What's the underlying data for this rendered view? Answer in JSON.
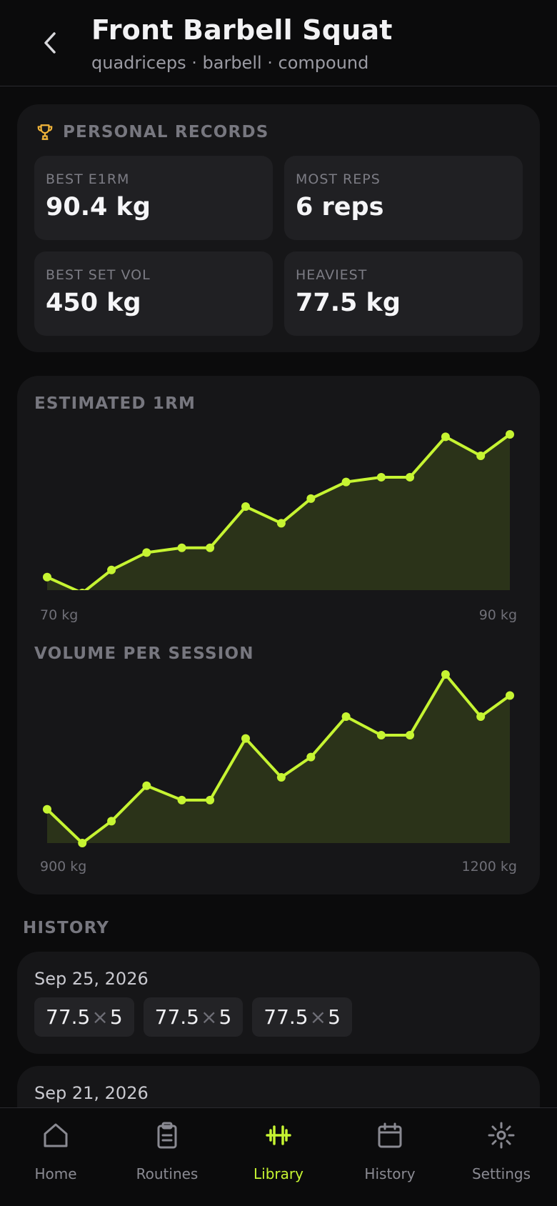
{
  "header": {
    "title": "Front Barbell Squat",
    "subtitle": "quadriceps · barbell · compound"
  },
  "personal_records": {
    "heading": "PERSONAL RECORDS",
    "stats": [
      {
        "label": "BEST E1RM",
        "value": "90.4 kg"
      },
      {
        "label": "MOST REPS",
        "value": "6 reps"
      },
      {
        "label": "BEST SET VOL",
        "value": "450 kg"
      },
      {
        "label": "HEAVIEST",
        "value": "77.5 kg"
      }
    ]
  },
  "colors": {
    "accent": "#c6f432",
    "area_fill": "#2b3319",
    "trophy": "#f2b53a"
  },
  "chart_data": [
    {
      "type": "line",
      "title": "ESTIMATED 1RM",
      "min_label": "70 kg",
      "max_label": "90 kg",
      "x": [
        1,
        2,
        3,
        4,
        5,
        6,
        7,
        8,
        9,
        10,
        11,
        12,
        13,
        14,
        15
      ],
      "values": [
        0.1,
        0.0,
        0.145,
        0.255,
        0.285,
        0.285,
        0.545,
        0.44,
        0.595,
        0.7,
        0.73,
        0.73,
        0.985,
        0.865,
        1.0
      ],
      "area": true
    },
    {
      "type": "line",
      "title": "VOLUME PER SESSION",
      "min_label": "900 kg",
      "max_label": "1200 kg",
      "x": [
        1,
        2,
        3,
        4,
        5,
        6,
        7,
        8,
        9,
        10,
        11,
        12,
        13,
        14,
        15
      ],
      "values": [
        0.2,
        0.0,
        0.13,
        0.34,
        0.255,
        0.255,
        0.62,
        0.39,
        0.51,
        0.75,
        0.64,
        0.64,
        1.0,
        0.75,
        0.875
      ],
      "area": true
    }
  ],
  "history": {
    "heading": "HISTORY",
    "sessions": [
      {
        "date": "Sep 25, 2026",
        "sets": [
          {
            "weight": "77.5",
            "x": "×",
            "reps": "5"
          },
          {
            "weight": "77.5",
            "x": "×",
            "reps": "5"
          },
          {
            "weight": "77.5",
            "x": "×",
            "reps": "5"
          }
        ]
      },
      {
        "date": "Sep 21, 2026"
      }
    ]
  },
  "tabbar": {
    "tabs": [
      {
        "label": "Home",
        "icon": "home-icon"
      },
      {
        "label": "Routines",
        "icon": "clipboard-icon"
      },
      {
        "label": "Library",
        "icon": "dumbbell-icon",
        "active": true
      },
      {
        "label": "History",
        "icon": "calendar-icon"
      },
      {
        "label": "Settings",
        "icon": "gear-icon"
      }
    ]
  }
}
